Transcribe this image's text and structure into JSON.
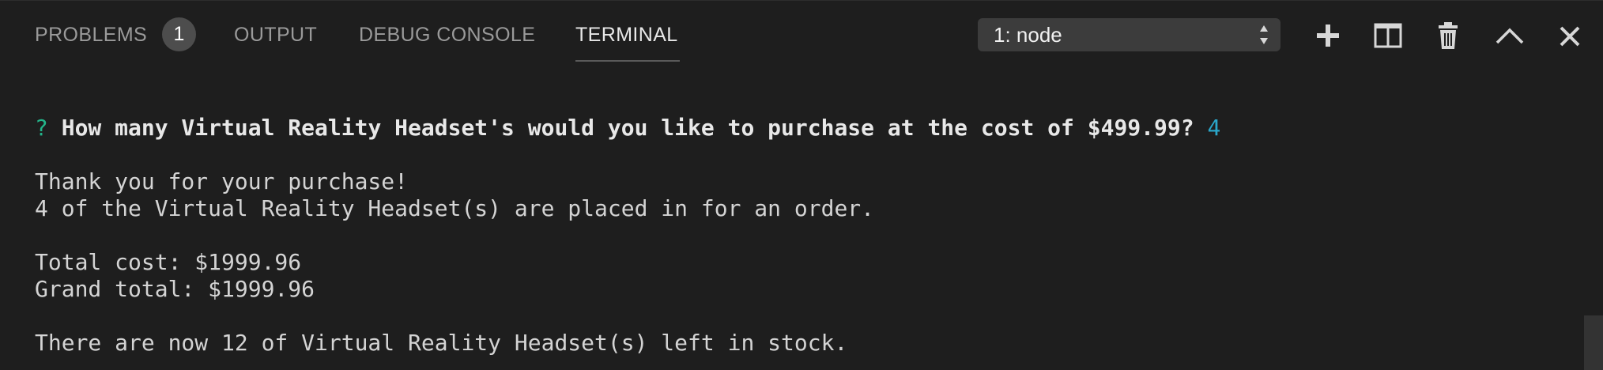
{
  "tabs": [
    {
      "label": "PROBLEMS",
      "badge": "1",
      "active": false
    },
    {
      "label": "OUTPUT",
      "active": false
    },
    {
      "label": "DEBUG CONSOLE",
      "active": false
    },
    {
      "label": "TERMINAL",
      "active": true
    }
  ],
  "terminal_selector": {
    "value": "1: node",
    "icon": "dropdown-arrows-icon"
  },
  "actions": [
    {
      "name": "new-terminal-button",
      "icon": "plus-icon"
    },
    {
      "name": "split-terminal-button",
      "icon": "split-panel-icon"
    },
    {
      "name": "kill-terminal-button",
      "icon": "trash-icon"
    },
    {
      "name": "maximize-panel-button",
      "icon": "chevron-up-icon"
    },
    {
      "name": "close-panel-button",
      "icon": "close-icon"
    }
  ],
  "terminal": {
    "prompt_mark": "?",
    "question": "How many Virtual Reality Headset's would you like to purchase at the cost of $499.99?",
    "answer": "4",
    "lines": [
      "Thank you for your purchase!",
      "4 of the Virtual Reality Headset(s) are placed in for an order.",
      "Total cost: $1999.96",
      "Grand total: $1999.96",
      "There are now 12 of Virtual Reality Headset(s) left in stock."
    ]
  },
  "colors": {
    "background": "#1e1e1e",
    "prompt_mark": "#23b58a",
    "answer": "#2aa6c9",
    "active_tab": "#e7e7e7",
    "inactive_tab": "#9a9a9a"
  }
}
